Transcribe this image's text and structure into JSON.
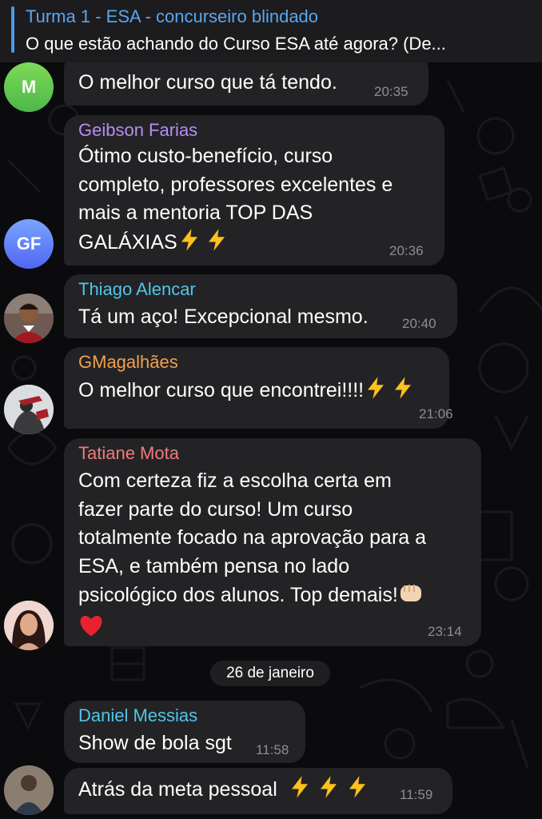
{
  "pinned": {
    "title": "Turma 1 - ESA - concurseiro blindado",
    "text": "O que estão achando do Curso ESA até agora? (De..."
  },
  "messages": [
    {
      "sender": "",
      "lines": [
        "O melhor curso que tá tendo."
      ],
      "time": "20:35"
    },
    {
      "sender": "Geibson Farias",
      "lines": [
        "Ótimo custo-benefício, curso",
        "completo, professores excelentes e",
        "mais a mentoria TOP DAS",
        "GALÁXIAS"
      ],
      "time": "20:36",
      "avatar": "GF"
    },
    {
      "sender": "Thiago Alencar",
      "lines": [
        "Tá um aço! Excepcional mesmo."
      ],
      "time": "20:40"
    },
    {
      "sender": "GMagalhães",
      "lines": [
        "O melhor curso que encontrei!!!!"
      ],
      "time": "21:06"
    },
    {
      "sender": "Tatiane Mota",
      "lines": [
        "Com certeza fiz a escolha certa em",
        "fazer parte do curso! Um curso",
        "totalmente focado na aprovação para a",
        "ESA, e também pensa no lado",
        "psicológico dos alunos. Top demais!"
      ],
      "time": "23:14"
    },
    {
      "sender": "Daniel Messias",
      "lines": [
        "Show de bola sgt"
      ],
      "time": "11:58"
    },
    {
      "sender": "",
      "lines": [
        "Atrás da meta pessoal"
      ],
      "time": "11:59"
    }
  ],
  "first_avatar_initial": "M",
  "date_separator": "26 de janeiro",
  "colors": {
    "accent": "#4a9be8",
    "geibson": "#b98cf0",
    "thiago": "#4fc6e8",
    "gmagalhaes": "#f0a14e",
    "tatiane": "#f07a7a",
    "daniel": "#4fc6e8"
  },
  "icons": [
    "lightning-emoji",
    "fist-emoji",
    "heart-emoji"
  ]
}
